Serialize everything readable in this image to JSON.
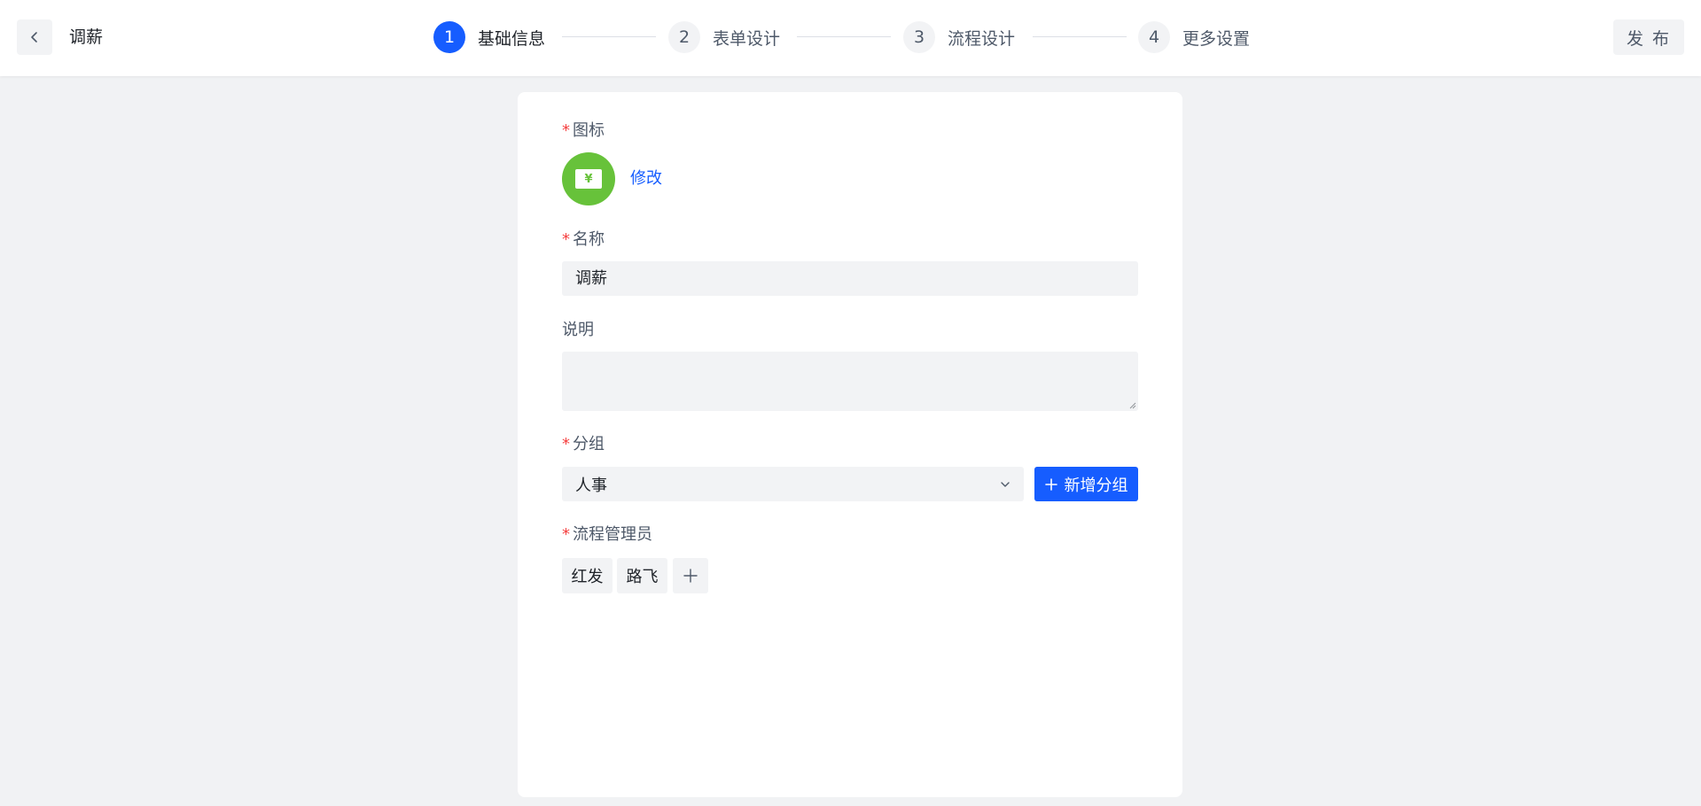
{
  "header": {
    "title": "调薪",
    "back_icon": "chevron-left-icon",
    "publish_label": "发 布",
    "steps": [
      {
        "num": "1",
        "label": "基础信息",
        "active": true
      },
      {
        "num": "2",
        "label": "表单设计",
        "active": false
      },
      {
        "num": "3",
        "label": "流程设计",
        "active": false
      },
      {
        "num": "4",
        "label": "更多设置",
        "active": false
      }
    ]
  },
  "form": {
    "required_mark": "*",
    "icon": {
      "label": "图标",
      "icon_name": "money-icon",
      "glyph": "¥",
      "color": "#67c23a",
      "modify_label": "修改"
    },
    "name": {
      "label": "名称",
      "value": "调薪"
    },
    "description": {
      "label": "说明",
      "value": ""
    },
    "group": {
      "label": "分组",
      "selected": "人事",
      "add_label": "新增分组"
    },
    "admins": {
      "label": "流程管理员",
      "tags": [
        "红发",
        "路飞"
      ]
    }
  },
  "colors": {
    "accent": "#165dff",
    "required": "#f53f3f",
    "icon_bg": "#67c23a",
    "page_bg": "#f1f2f4"
  }
}
